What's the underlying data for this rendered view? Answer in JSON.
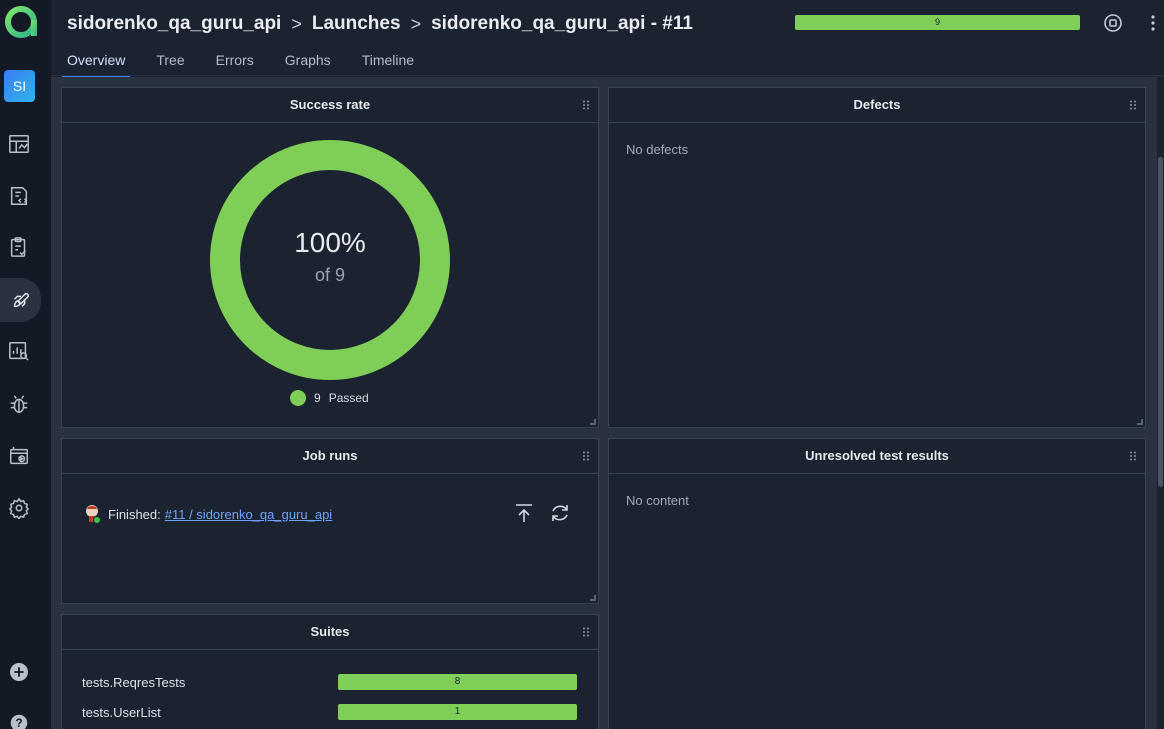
{
  "sidebar": {
    "avatar": "SI",
    "icons": [
      "dashboard-icon",
      "test-cases-icon",
      "test-plans-icon",
      "launches-icon",
      "analytics-icon",
      "defects-icon",
      "jobs-icon",
      "settings-icon",
      "add-icon",
      "help-icon"
    ]
  },
  "header": {
    "breadcrumb": [
      "sidorenko_qa_guru_api",
      "Launches",
      "sidorenko_qa_guru_api - #11"
    ],
    "progress_count": "9"
  },
  "tabs": [
    "Overview",
    "Tree",
    "Errors",
    "Graphs",
    "Timeline"
  ],
  "success_rate": {
    "title": "Success rate",
    "percent": "100%",
    "of_label": "of 9",
    "legend_count": "9",
    "legend_label": "Passed"
  },
  "defects": {
    "title": "Defects",
    "empty": "No defects"
  },
  "job_runs": {
    "title": "Job runs",
    "status": "Finished:",
    "link": "#11 / sidorenko_qa_guru_api"
  },
  "unresolved": {
    "title": "Unresolved test results",
    "empty": "No content"
  },
  "suites": {
    "title": "Suites",
    "rows": [
      {
        "name": "tests.ReqresTests",
        "count": "8"
      },
      {
        "name": "tests.UserList",
        "count": "1"
      }
    ]
  },
  "colors": {
    "passed": "#7fce57",
    "accent": "#3b82f6",
    "background": "#1b2230"
  }
}
